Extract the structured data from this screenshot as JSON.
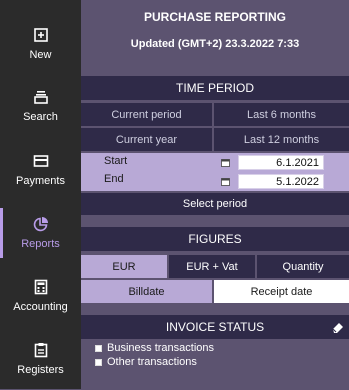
{
  "sidebar": {
    "items": [
      {
        "label": "New",
        "icon": "plus-square-icon"
      },
      {
        "label": "Search",
        "icon": "stack-icon"
      },
      {
        "label": "Payments",
        "icon": "card-icon"
      },
      {
        "label": "Reports",
        "icon": "pie-chart-icon",
        "active": true
      },
      {
        "label": "Accounting",
        "icon": "calculator-icon"
      },
      {
        "label": "Registers",
        "icon": "register-icon"
      }
    ]
  },
  "header": {
    "title": "PURCHASE REPORTING",
    "updated": "Updated (GMT+2)  23.3.2022 7:33"
  },
  "time_period": {
    "title": "TIME PERIOD",
    "options": [
      "Current period",
      "Last 6 months",
      "Current year",
      "Last 12 months"
    ],
    "start_label": "Start",
    "start_value": "6.1.2021",
    "end_label": "End",
    "end_value": "5.1.2022",
    "select_label": "Select period"
  },
  "figures": {
    "title": "FIGURES",
    "currency_options": [
      "EUR",
      "EUR + Vat",
      "Quantity"
    ],
    "currency_selected": "EUR",
    "date_options": [
      "Billdate",
      "Receipt date"
    ],
    "date_selected": "Billdate"
  },
  "invoice_status": {
    "title": "INVOICE STATUS",
    "options": [
      "Business transactions",
      "Other transactions"
    ]
  },
  "colors": {
    "sidebar_bg": "#2b2b2b",
    "main_bg": "#5c5370",
    "section_dark": "#2f2a48",
    "selected_light": "#b8a9d6",
    "active_accent": "#b89ce8"
  }
}
